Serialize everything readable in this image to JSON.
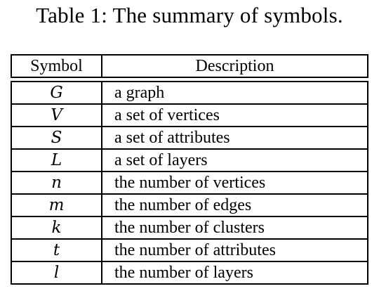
{
  "caption": "Table 1: The summary of symbols.",
  "table": {
    "headers": [
      "Symbol",
      "Description"
    ],
    "rows": [
      {
        "symbol": "G",
        "description": "a graph"
      },
      {
        "symbol": "V",
        "description": "a set of vertices"
      },
      {
        "symbol": "S",
        "description": "a set of attributes"
      },
      {
        "symbol": "L",
        "description": "a set of layers"
      },
      {
        "symbol": "n",
        "description": "the number of vertices"
      },
      {
        "symbol": "m",
        "description": "the number of edges"
      },
      {
        "symbol": "k",
        "description": "the number of clusters"
      },
      {
        "symbol": "t",
        "description": "the number of attributes"
      },
      {
        "symbol": "l",
        "description": "the number of layers"
      }
    ]
  }
}
